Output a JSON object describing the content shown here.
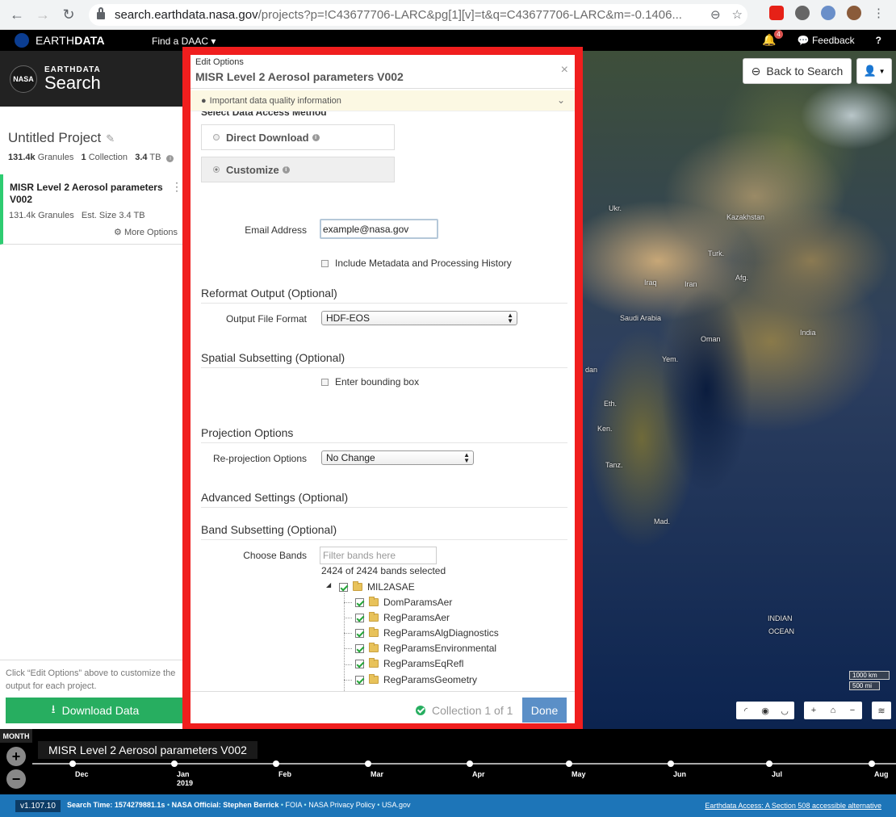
{
  "browser": {
    "url_host": "search.earthdata.nasa.gov",
    "url_path": "/projects?p=!C43677706-LARC&pg[1][v]=t&q=C43677706-LARC&m=-0.1406..."
  },
  "topbar": {
    "logo_prefix": "EARTH",
    "logo_bold": "DATA",
    "find_daac": "Find a DAAC ▾",
    "notifications_count": "4",
    "feedback": "Feedback",
    "help": "?"
  },
  "sidebar": {
    "brand_top": "EARTHDATA",
    "brand_main": "Search",
    "nasa": "NASA",
    "project_title": "Untitled Project",
    "stats": {
      "granules": "131.4k",
      "granules_label": "Granules",
      "collections": "1",
      "collections_label": "Collection",
      "size": "3.4",
      "size_unit": "TB"
    },
    "collection": {
      "title": "MISR Level 2 Aerosol parameters V002",
      "granules": "131.4k Granules",
      "size": "Est. Size 3.4 TB",
      "more_options": "More Options"
    },
    "hint": "Click “Edit Options” above to customize the output for each project.",
    "download_button": "Download Data"
  },
  "map": {
    "back_to_search": "Back to Search",
    "labels": [
      "Ukr.",
      "Kazakhstan",
      "Turk.",
      "Iraq",
      "Iran",
      "Afg.",
      "Saudi Arabia",
      "Oman",
      "India",
      "Yem.",
      "dan",
      "Eth.",
      "Ken.",
      "Tanz.",
      "Mad.",
      "INDIAN",
      "OCEAN"
    ],
    "scale_km": "1000 km",
    "scale_mi": "500 mi"
  },
  "modal": {
    "subtitle": "Edit Options",
    "title": "MISR Level 2 Aerosol parameters V002",
    "quality_notice": "Important data quality information",
    "access_heading": "Select Data Access Method",
    "method_direct": "Direct Download",
    "method_customize": "Customize",
    "email_label": "Email Address",
    "email_value": "example@nasa.gov",
    "include_metadata": "Include Metadata and Processing History",
    "reformat_heading": "Reformat Output (Optional)",
    "output_format_label": "Output File Format",
    "output_format_value": "HDF-EOS",
    "spatial_heading": "Spatial Subsetting (Optional)",
    "bounding_box": "Enter bounding box",
    "projection_heading": "Projection Options",
    "reprojection_label": "Re-projection Options",
    "reprojection_value": "No Change",
    "advanced_heading": "Advanced Settings (Optional)",
    "band_heading": "Band Subsetting (Optional)",
    "choose_bands_label": "Choose Bands",
    "filter_placeholder": "Filter bands here",
    "bands_selected": "2424 of 2424 bands selected",
    "tree_root": "MIL2ASAE",
    "tree_children": [
      "DomParamsAer",
      "RegParamsAer",
      "RegParamsAlgDiagnostics",
      "RegParamsEnvironmental",
      "RegParamsEqRefl",
      "RegParamsGeometry"
    ],
    "collection_status": "Collection 1 of 1",
    "done": "Done"
  },
  "timeline": {
    "zoom_label": "MONTH",
    "title": "MISR Level 2 Aerosol parameters V002",
    "months": [
      "Dec",
      "Jan",
      "Feb",
      "Mar",
      "Apr",
      "May",
      "Jun",
      "Jul",
      "Aug"
    ],
    "year": "2019"
  },
  "footer": {
    "version": "v1.107.10",
    "search_time": "Search Time: 1574279881.1s",
    "official": "NASA Official: Stephen Berrick",
    "foia": "FOIA",
    "privacy": "NASA Privacy Policy",
    "usa": "USA.gov",
    "accessible": "Earthdata Access: A Section 508 accessible alternative"
  },
  "colors": {
    "frame": "#f01e1e",
    "download": "#27ae60",
    "done": "#5b8fc7",
    "footer": "#1d75b8"
  }
}
